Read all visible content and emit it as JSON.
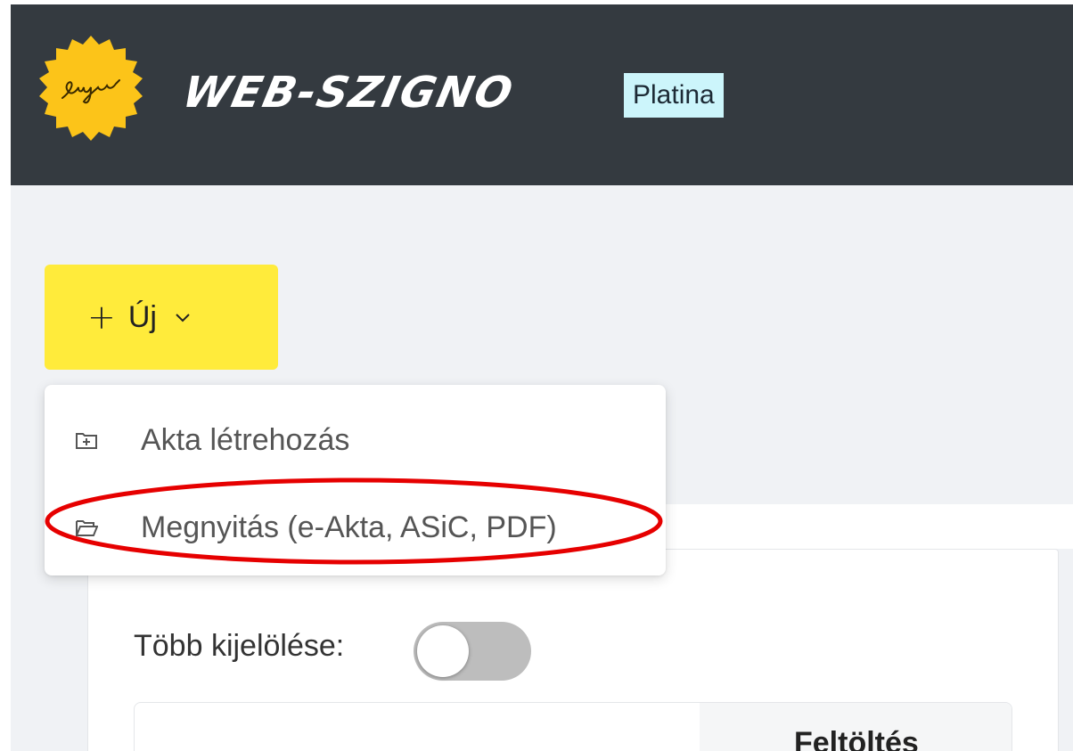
{
  "header": {
    "logo_signature_text": "Szignó",
    "app_name": "WEB-SZIGNO",
    "edition_badge": "Platina",
    "background_color": "#343a40",
    "seal_color": "#fcc419"
  },
  "toolbar": {
    "new_button": {
      "icon": "plus-icon",
      "label": "Új",
      "chevron_icon": "chevron-down-icon",
      "color": "#ffeb3b"
    }
  },
  "new_menu": {
    "items": [
      {
        "icon": "folder-plus-icon",
        "label": "Akta létrehozás"
      },
      {
        "icon": "folder-open-icon",
        "label": "Megnyitás (e-Akta, ASiC, PDF)",
        "highlighted": true
      }
    ],
    "highlight_color": "#e60000"
  },
  "main": {
    "multi_select": {
      "label": "Több kijelölése",
      "separator": ":",
      "toggle_on": false
    },
    "table": {
      "columns": [
        "Feltöltés"
      ]
    }
  }
}
